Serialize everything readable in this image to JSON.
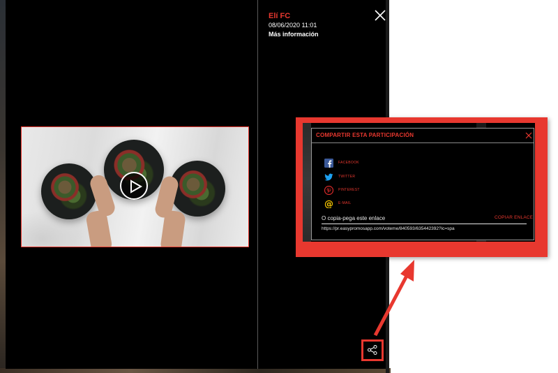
{
  "post": {
    "author": "Elí FC",
    "date": "08/06/2020 11:01",
    "more_info": "Más información"
  },
  "share_panel": {
    "title": "COMPARTIR ESTA PARTICIPACIÓN",
    "options": [
      {
        "label": "FACEBOOK",
        "icon": "facebook-icon",
        "color": "#3b5998"
      },
      {
        "label": "TWITTER",
        "icon": "twitter-icon",
        "color": "#1da1f2"
      },
      {
        "label": "PINTEREST",
        "icon": "pinterest-icon",
        "color": "#e02b2b"
      },
      {
        "label": "E-MAIL",
        "icon": "at-sign-icon",
        "color": "#f2c200"
      }
    ],
    "copy_label": "O copia-pega este enlace",
    "copy_button": "COPIAR ENLACE",
    "url": "https://pr.easypromosapp.com/voteme/840593/635442392?ic=spa"
  },
  "colors": {
    "accent": "#e8382f",
    "modal_bg": "#000000"
  }
}
